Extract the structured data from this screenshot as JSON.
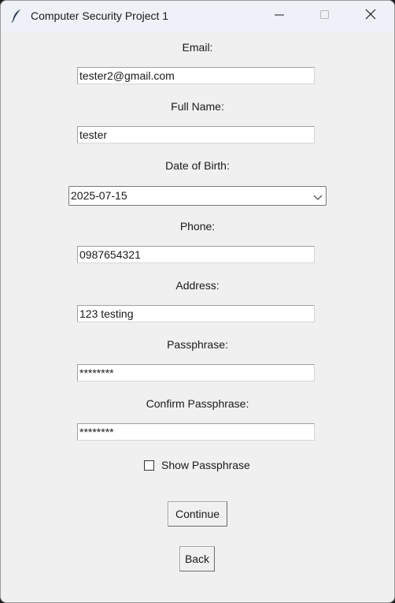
{
  "window": {
    "title": "Computer Security Project 1"
  },
  "form": {
    "email_label": "Email:",
    "email_value": "tester2@gmail.com",
    "fullname_label": "Full Name:",
    "fullname_value": "tester",
    "dob_label": "Date of Birth:",
    "dob_value": "2025-07-15",
    "phone_label": "Phone:",
    "phone_value": "0987654321",
    "address_label": "Address:",
    "address_value": "123 testing",
    "passphrase_label": "Passphrase:",
    "passphrase_value": "********",
    "confirm_label": "Confirm Passphrase:",
    "confirm_value": "********",
    "show_passphrase_label": "Show Passphrase",
    "show_passphrase_checked": false
  },
  "buttons": {
    "continue_label": "Continue",
    "back_label": "Back"
  },
  "icons": {
    "app": "feather-icon",
    "minimize": "minimize-icon",
    "maximize": "maximize-icon",
    "close": "close-icon",
    "dropdown": "chevron-down-icon"
  }
}
